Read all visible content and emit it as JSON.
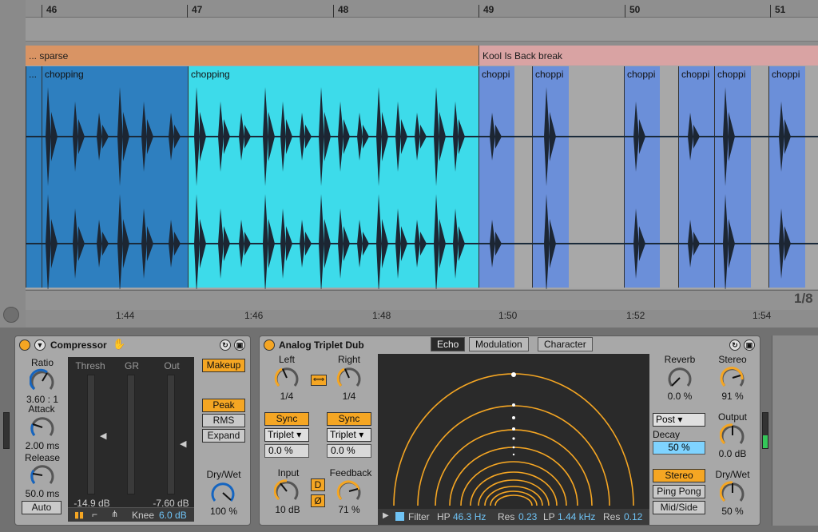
{
  "arrangement": {
    "bars": [
      "46",
      "47",
      "48",
      "49",
      "50",
      "51"
    ],
    "groups": [
      {
        "label": "... sparse",
        "color": "#d99464"
      },
      {
        "label": "Kool Is Back break",
        "color": "#d9a3a3"
      }
    ],
    "clips": [
      {
        "label": "...",
        "color": "#2e7fbf"
      },
      {
        "label": "chopping",
        "color": "#2e7fbf"
      },
      {
        "label": "chopping",
        "color": "#3ddbea"
      },
      {
        "label": "choppi",
        "color": "#6b8fd9"
      },
      {
        "label": "choppi",
        "color": "#6b8fd9"
      },
      {
        "label": "choppi",
        "color": "#6b8fd9"
      },
      {
        "label": "choppi",
        "color": "#6b8fd9"
      },
      {
        "label": "choppi",
        "color": "#6b8fd9"
      },
      {
        "label": "choppi",
        "color": "#6b8fd9"
      }
    ],
    "times": [
      "1:44",
      "1:46",
      "1:48",
      "1:50",
      "1:52",
      "1:54"
    ],
    "zoom_label": "1/8"
  },
  "compressor": {
    "title": "Compressor",
    "ratio_label": "Ratio",
    "ratio_value": "3.60 : 1",
    "attack_label": "Attack",
    "attack_value": "2.00 ms",
    "release_label": "Release",
    "release_value": "50.0 ms",
    "auto_label": "Auto",
    "thresh_label": "Thresh",
    "gr_label": "GR",
    "out_label": "Out",
    "thresh_value": "-14.9 dB",
    "out_value": "-7.60 dB",
    "knee_label": "Knee",
    "knee_value": "6.0 dB",
    "makeup_label": "Makeup",
    "peak_label": "Peak",
    "rms_label": "RMS",
    "expand_label": "Expand",
    "drywet_label": "Dry/Wet",
    "drywet_value": "100 %"
  },
  "echo": {
    "title": "Analog Triplet Dub",
    "tabs": [
      "Echo",
      "Modulation",
      "Character"
    ],
    "left_label": "Left",
    "left_value": "1/4",
    "right_label": "Right",
    "right_value": "1/4",
    "sync_label": "Sync",
    "mode_value": "Triplet",
    "offset_value": "0.0 %",
    "input_label": "Input",
    "input_value": "10 dB",
    "feedback_label": "Feedback",
    "feedback_value": "71 %",
    "d_label": "D",
    "phase_label": "Ø",
    "filter_label": "Filter",
    "hp_label": "HP",
    "hp_value": "46.3 Hz",
    "res1_label": "Res",
    "res1_value": "0.23",
    "lp_label": "LP",
    "lp_value": "1.44 kHz",
    "res2_label": "Res",
    "res2_value": "0.12",
    "reverb_label": "Reverb",
    "reverb_value": "0.0 %",
    "stereo_label": "Stereo",
    "stereo_value": "91 %",
    "post_value": "Post",
    "decay_label": "Decay",
    "decay_value": "50 %",
    "output_label": "Output",
    "output_value": "0.0 dB",
    "stereo_btn": "Stereo",
    "pingpong_btn": "Ping Pong",
    "midside_btn": "Mid/Side",
    "drywet_label": "Dry/Wet",
    "drywet_value": "50 %"
  },
  "colors": {
    "accent": "#f5a623",
    "blue_value": "#1565c0",
    "display_bg": "#2a2a2a"
  }
}
